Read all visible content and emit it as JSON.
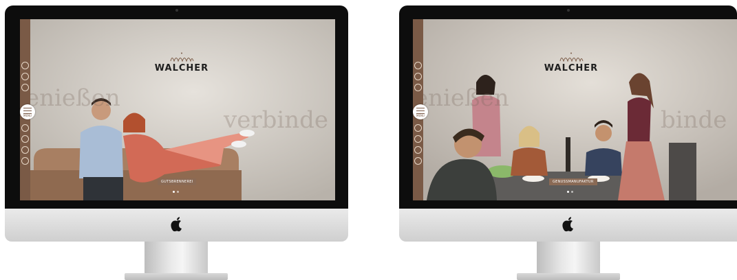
{
  "monitors": [
    {
      "brand": "WALCHER",
      "menu_label": "MENU",
      "script_words": [
        "enießen",
        "verbinde"
      ],
      "cta_label": "GUTSBRENNEREI",
      "slide_count": 2,
      "active_slide": 1,
      "side_icons": [
        "user-icon",
        "phone-icon",
        "mail-icon",
        "search-icon",
        "pin-icon",
        "linkedin-icon",
        "globe-icon"
      ],
      "device_logo": "apple-icon"
    },
    {
      "brand": "WALCHER",
      "menu_label": "MENU",
      "script_words": [
        "enießen",
        "binde"
      ],
      "cta_label": "GENUSSMANUFAKTUR",
      "slide_count": 2,
      "active_slide": 1,
      "side_icons": [
        "user-icon",
        "phone-icon",
        "mail-icon",
        "search-icon",
        "pin-icon",
        "linkedin-icon",
        "globe-icon"
      ],
      "device_logo": "apple-icon"
    }
  ],
  "colors": {
    "sidebar": "#7a5a46",
    "cta_background": "#8a6a55",
    "brand_text": "#1e1e1e"
  }
}
